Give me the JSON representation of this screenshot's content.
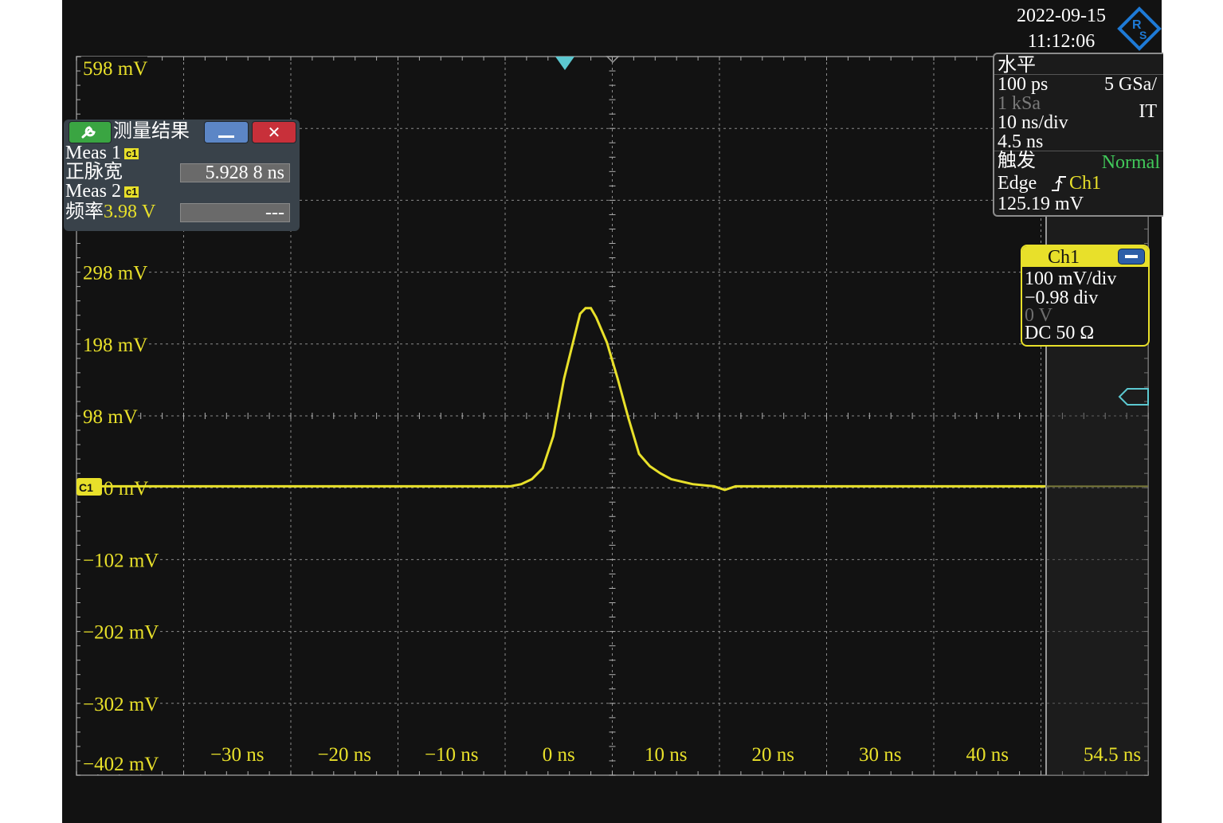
{
  "status": {
    "date": "2022-09-15",
    "time": "11:12:06",
    "logo_text": "R&S"
  },
  "horizontal": {
    "title": "水平",
    "resolution": "100 ps",
    "sample_rate": "5 GSa/",
    "record_length": "1 kSa",
    "mode": "IT",
    "time_scale": "10 ns/div",
    "position": "4.5 ns"
  },
  "trigger": {
    "title": "触发",
    "mode": "Normal",
    "type": "Edge",
    "source": "Ch1",
    "level": "125.19 mV"
  },
  "channel": {
    "name": "Ch1",
    "scale": "100 mV/div",
    "offset_div": "−0.98 div",
    "offset_v": "0 V",
    "coupling": "DC 50 Ω",
    "marker": "C1"
  },
  "measurement": {
    "title": "测量结果",
    "meas1": {
      "label": "Meas 1",
      "channel": "c1",
      "name": "正脉宽",
      "value": "5.928 8 ns"
    },
    "meas2": {
      "label": "Meas 2",
      "channel": "c1",
      "name": "频率",
      "level": "3.98 V",
      "value": "---"
    }
  },
  "colors": {
    "trace": "#e8e02a",
    "trigger_marker": "#5cc8d0",
    "grid": "#8a8a8a",
    "background": "#121212"
  },
  "icons": [
    "wrench-icon",
    "minimize-icon",
    "close-icon",
    "rs-logo-icon",
    "edge-rising-icon",
    "collapse-icon"
  ],
  "chart_data": {
    "type": "line",
    "y_tick_labels": [
      "598 mV",
      "298 mV",
      "198 mV",
      "98 mV",
      "0 mV",
      "−102 mV",
      "−202 mV",
      "−302 mV",
      "−402 mV"
    ],
    "x_tick_labels": [
      "−30 ns",
      "−20 ns",
      "−10 ns",
      "0 ns",
      "10 ns",
      "20 ns",
      "30 ns",
      "40 ns",
      "54.5 ns"
    ],
    "xlim": [
      -45.5,
      54.5
    ],
    "ylim": [
      -402,
      598
    ],
    "grid": true,
    "series": [
      {
        "x": [
          -45.5,
          -5,
          -4,
          -3,
          -2,
          -1,
          0,
          1,
          1.5,
          2,
          2.5,
          3,
          4,
          5,
          6,
          7,
          8,
          9,
          10,
          12,
          14,
          15,
          16,
          45
        ],
        "y": [
          0,
          0,
          3,
          10,
          25,
          70,
          150,
          210,
          240,
          248,
          248,
          235,
          200,
          150,
          95,
          45,
          28,
          18,
          10,
          3,
          0,
          -5,
          0,
          0
        ]
      }
    ]
  }
}
